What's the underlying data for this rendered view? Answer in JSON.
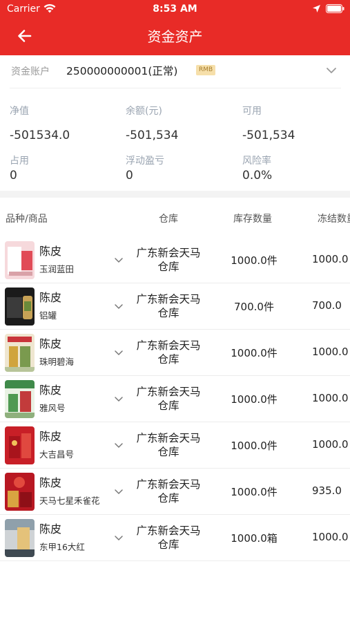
{
  "status_bar": {
    "carrier": "Carrier",
    "time": "8:53 AM"
  },
  "nav": {
    "title": "资金资产"
  },
  "account": {
    "label": "资金账户",
    "value": "250000000001(正常)",
    "currency": "RMB"
  },
  "metrics": [
    {
      "label": "净值",
      "value": "-501534.0"
    },
    {
      "label": "余额(元)",
      "value": "-501,534"
    },
    {
      "label": "可用",
      "value": "-501,534"
    },
    {
      "label": "占用",
      "value": "0"
    },
    {
      "label": "浮动盈亏",
      "value": "0"
    },
    {
      "label": "风险率",
      "value": "0.0%"
    }
  ],
  "table": {
    "headers": [
      "品种/商品",
      "仓库",
      "库存数量",
      "冻结数量"
    ],
    "rows": [
      {
        "category": "陈皮",
        "product": "玉润蓝田",
        "warehouse": "广东新会天马仓库",
        "stock": "1000.0件",
        "frozen": "1000.0"
      },
      {
        "category": "陈皮",
        "product": "铝罐",
        "warehouse": "广东新会天马仓库",
        "stock": "700.0件",
        "frozen": "700.0"
      },
      {
        "category": "陈皮",
        "product": "珠明碧海",
        "warehouse": "广东新会天马仓库",
        "stock": "1000.0件",
        "frozen": "1000.0"
      },
      {
        "category": "陈皮",
        "product": "雅风号",
        "warehouse": "广东新会天马仓库",
        "stock": "1000.0件",
        "frozen": "1000.0"
      },
      {
        "category": "陈皮",
        "product": "大吉昌号",
        "warehouse": "广东新会天马仓库",
        "stock": "1000.0件",
        "frozen": "1000.0"
      },
      {
        "category": "陈皮",
        "product": "天马七星禾雀花",
        "warehouse": "广东新会天马仓库",
        "stock": "1000.0件",
        "frozen": "935.0"
      },
      {
        "category": "陈皮",
        "product": "东甲16大红",
        "warehouse": "广东新会天马仓库",
        "stock": "1000.0箱",
        "frozen": "1000.0"
      }
    ]
  },
  "colors": {
    "brand_red": "#e82b27",
    "badge_bg": "#f6dfaa",
    "label_gray": "#9aa4b1"
  }
}
